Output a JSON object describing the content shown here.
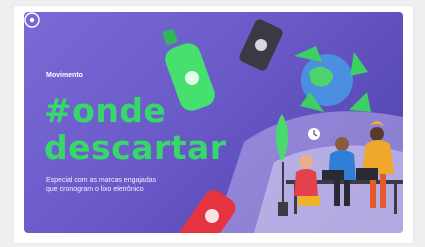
{
  "card": {
    "kicker": "Movimento",
    "headline_line1": "#onde",
    "headline_line2": "descartar",
    "subtitle_line1": "Especial com as marcas engajadas",
    "subtitle_line2": "que cronogram o lixo eletrônico",
    "logo_icon": "brand-logo-icon"
  },
  "colors": {
    "background_purple": "#6a5ac8",
    "headline_green": "#37d86a",
    "text_white": "#ffffff"
  }
}
